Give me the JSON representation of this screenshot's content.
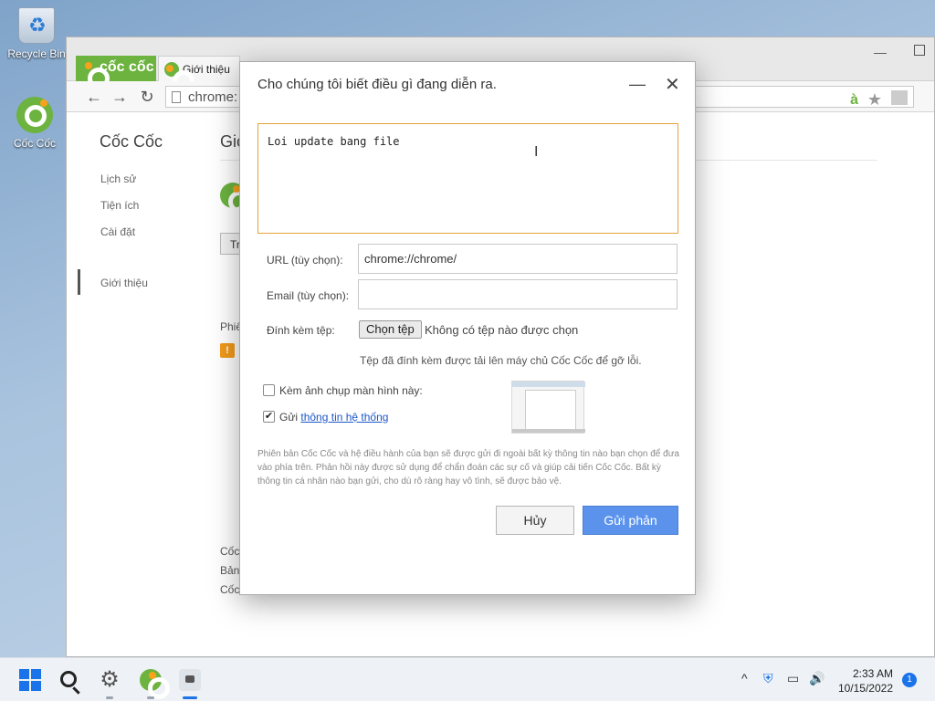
{
  "desktop": {
    "recycle_bin": "Recycle Bin",
    "coccoc": "Cốc Cốc"
  },
  "browser": {
    "brand": "cốc cốc",
    "tab_title": "Giới thiệu",
    "address": "chrome:",
    "omni_a": "à",
    "sidebar": {
      "title": "Cốc Cốc",
      "items": [
        {
          "label": "Lịch sử"
        },
        {
          "label": "Tiện ích"
        },
        {
          "label": "Cài đặt"
        },
        {
          "label": "Giới thiệu"
        }
      ]
    },
    "main": {
      "title": "Giớ",
      "button": "Tr",
      "version_label": "Phiê",
      "warn": "!",
      "footer_lines": [
        "Cốc",
        "Bản",
        "Cốc"
      ]
    }
  },
  "dialog": {
    "title": "Cho chúng tôi biết điều gì đang diễn ra.",
    "description_value": "Loi update bang file",
    "caret": "I",
    "url_label": "URL (tùy chọn):",
    "url_value": "chrome://chrome/",
    "email_label": "Email (tùy chọn):",
    "email_value": "",
    "attach_label": "Đính kèm tệp:",
    "attach_button": "Chọn tệp",
    "attach_status": "Không có tệp nào được chọn",
    "attach_note": "Tệp đã đính kèm được tải lên máy chủ Cốc Cốc để gỡ lỗi.",
    "screenshot_checkbox": {
      "label": "Kèm ảnh chụp màn hình này:",
      "checked": false
    },
    "sysinfo_checkbox": {
      "label_prefix": "Gửi ",
      "link": "thông tin hệ thống",
      "checked": true,
      "mark": "✔"
    },
    "disclaimer": "Phiên bản Cốc Cốc và hệ điều hành của bạn sẽ được gửi đi ngoài bất kỳ thông tin nào bạn chọn để đưa vào phía trên. Phản hồi này được sử dụng để chẩn đoán các sự cố và giúp cải tiến Cốc Cốc. Bất kỳ thông tin cá nhân nào bạn gửi, cho dù rõ ràng hay vô tình, sẽ được bảo vệ.",
    "cancel_button": "Hủy",
    "send_button": "Gửi phản"
  },
  "taskbar": {
    "time": "2:33 AM",
    "date": "10/15/2022",
    "notifications": "1",
    "tray_chevron": "^",
    "tray_shield": "⛨",
    "tray_display": "▭",
    "tray_volume": "🔊",
    "gear": "⚙"
  }
}
